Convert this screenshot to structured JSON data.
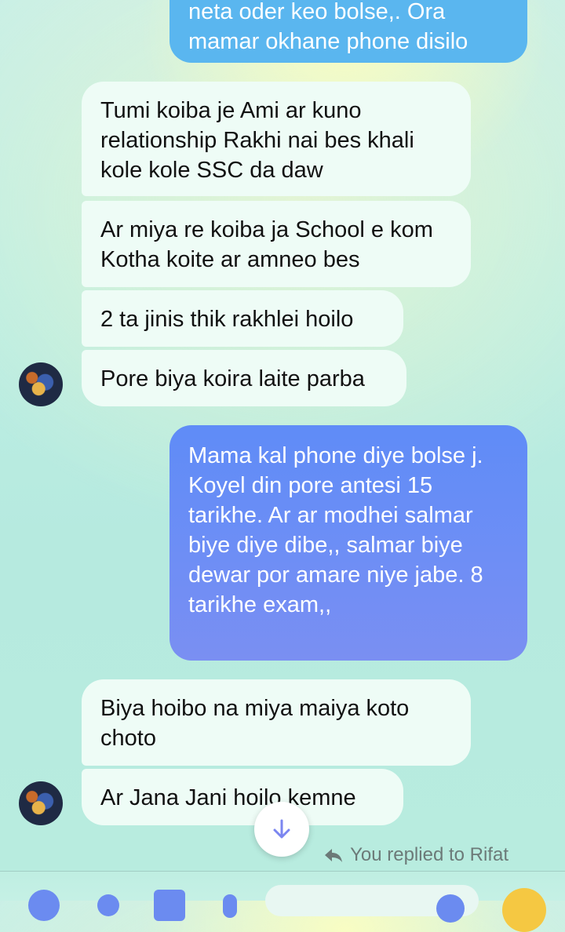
{
  "messages": [
    {
      "id": "m1",
      "direction": "outgoing",
      "text": "neta oder keo bolse,. Ora mamar okhane phone disilo"
    },
    {
      "id": "m2",
      "direction": "incoming",
      "text": "Tumi koiba je Ami ar kuno relationship Rakhi nai bes khali kole kole SSC da daw"
    },
    {
      "id": "m3",
      "direction": "incoming",
      "text": "Ar miya re koiba ja School e kom Kotha koite ar amneo bes"
    },
    {
      "id": "m4",
      "direction": "incoming",
      "text": "2 ta jinis thik rakhlei hoilo"
    },
    {
      "id": "m5",
      "direction": "incoming",
      "text": "Pore biya koira laite parba"
    },
    {
      "id": "m6",
      "direction": "outgoing",
      "text": "Mama kal phone diye bolse j.  Koyel din pore antesi 15 tarikhe.  Ar ar modhei salmar biye diye dibe,, salmar biye dewar por amare niye jabe.  8 tarikhe exam,,"
    },
    {
      "id": "m7",
      "direction": "incoming",
      "text": "Biya hoibo na miya maiya koto choto"
    },
    {
      "id": "m8",
      "direction": "incoming",
      "text": "Ar Jana Jani hoilo kemne"
    }
  ],
  "reply_note": "You replied to Rifat",
  "icons": {
    "scroll_down": "arrow-down-icon",
    "reply": "reply-arrow-icon",
    "avatar": "contact-avatar"
  },
  "colors": {
    "incoming_bubble": "#eefcf6",
    "outgoing_top": "#5ab6ef",
    "outgoing_main_start": "#5f8cf7",
    "outgoing_main_end": "#7a8ff2",
    "reply_note": "#6c7a78",
    "scroll_arrow": "#7b86f0"
  }
}
